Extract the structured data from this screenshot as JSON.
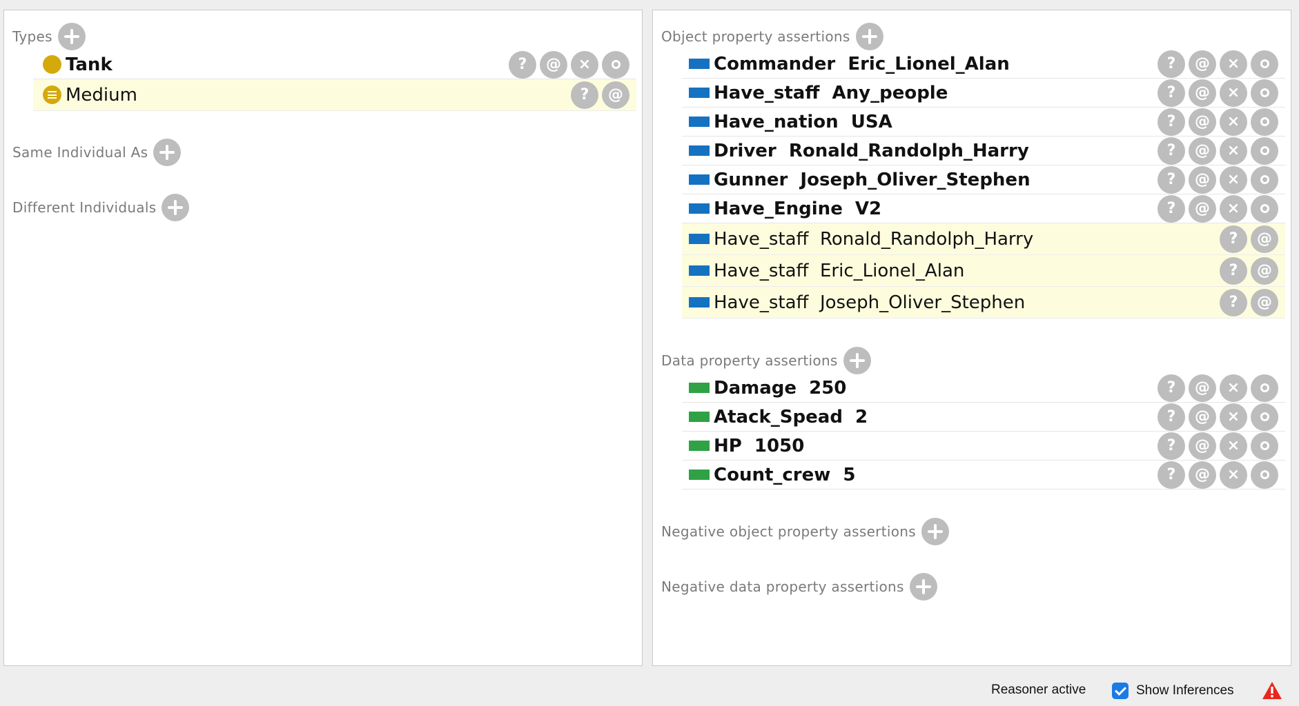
{
  "left_panel": {
    "types": {
      "header": "Types",
      "items": [
        {
          "label": "Tank",
          "kind": "asserted"
        },
        {
          "label": "Medium",
          "kind": "inferred"
        }
      ]
    },
    "same_individual": {
      "header": "Same Individual As"
    },
    "different_individuals": {
      "header": "Different Individuals"
    }
  },
  "right_panel": {
    "object_properties": {
      "header": "Object property assertions",
      "items": [
        {
          "label": "Commander  Eric_Lionel_Alan",
          "kind": "asserted"
        },
        {
          "label": "Have_staff  Any_people",
          "kind": "asserted"
        },
        {
          "label": "Have_nation  USA",
          "kind": "asserted"
        },
        {
          "label": "Driver  Ronald_Randolph_Harry",
          "kind": "asserted"
        },
        {
          "label": "Gunner  Joseph_Oliver_Stephen",
          "kind": "asserted"
        },
        {
          "label": "Have_Engine  V2",
          "kind": "asserted"
        },
        {
          "label": "Have_staff  Ronald_Randolph_Harry",
          "kind": "inferred"
        },
        {
          "label": "Have_staff  Eric_Lionel_Alan",
          "kind": "inferred"
        },
        {
          "label": "Have_staff  Joseph_Oliver_Stephen",
          "kind": "inferred"
        }
      ]
    },
    "data_properties": {
      "header": "Data property assertions",
      "items": [
        {
          "label": "Damage  250",
          "kind": "asserted"
        },
        {
          "label": "Atack_Spead  2",
          "kind": "asserted"
        },
        {
          "label": "HP  1050",
          "kind": "asserted"
        },
        {
          "label": "Count_crew  5",
          "kind": "asserted"
        }
      ]
    },
    "negative_object_properties": {
      "header": "Negative object property assertions"
    },
    "negative_data_properties": {
      "header": "Negative data property assertions"
    }
  },
  "actions": {
    "explain": "?",
    "annotate": "@",
    "delete": "×",
    "edit": "o"
  },
  "status_bar": {
    "reasoner": "Reasoner active",
    "show_inferences": "Show Inferences",
    "show_inferences_checked": true
  },
  "colors": {
    "class_icon": "#d4a90c",
    "object_property": "#1572c1",
    "data_property": "#2ea244",
    "inferred_row_bg": "#fdfdde"
  },
  "icons": {
    "class": "class-circle-icon",
    "equivalent_class": "equivalent-class-icon",
    "object_property": "object-property-icon",
    "data_property": "data-property-icon",
    "add": "plus-icon",
    "warning": "warning-icon"
  }
}
